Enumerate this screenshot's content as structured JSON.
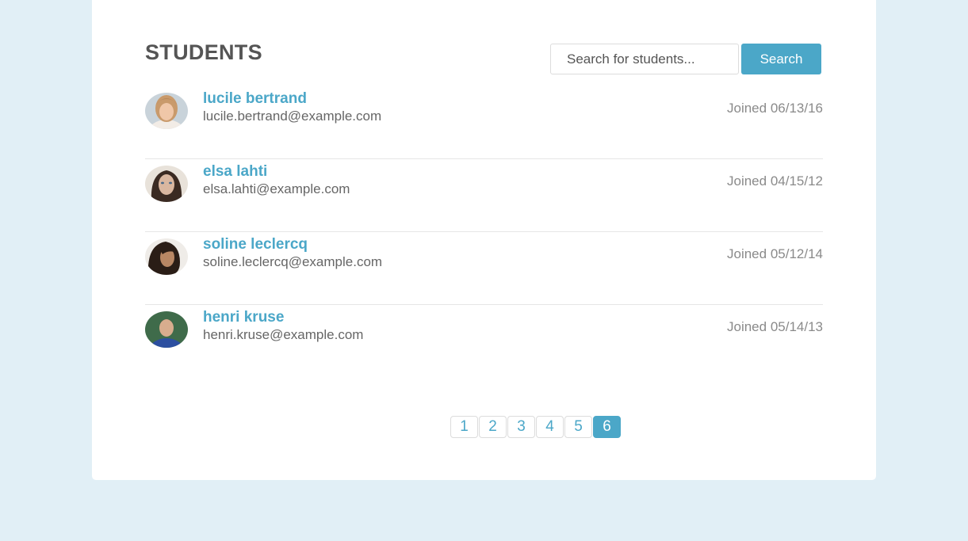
{
  "header": {
    "title": "STUDENTS"
  },
  "search": {
    "placeholder": "Search for students...",
    "value": "",
    "button_label": "Search"
  },
  "students": [
    {
      "name": "lucile bertrand",
      "email": "lucile.bertrand@example.com",
      "joined": "Joined 06/13/16"
    },
    {
      "name": "elsa lahti",
      "email": "elsa.lahti@example.com",
      "joined": "Joined 04/15/12"
    },
    {
      "name": "soline leclercq",
      "email": "soline.leclercq@example.com",
      "joined": "Joined 05/12/14"
    },
    {
      "name": "henri kruse",
      "email": "henri.kruse@example.com",
      "joined": "Joined 05/14/13"
    }
  ],
  "pagination": {
    "pages": [
      "1",
      "2",
      "3",
      "4",
      "5",
      "6"
    ],
    "current": "6"
  },
  "colors": {
    "accent": "#4ba7c8",
    "background": "#e1eff6",
    "card": "#ffffff",
    "title_text": "#555555",
    "muted_text": "#8a8a8a"
  }
}
